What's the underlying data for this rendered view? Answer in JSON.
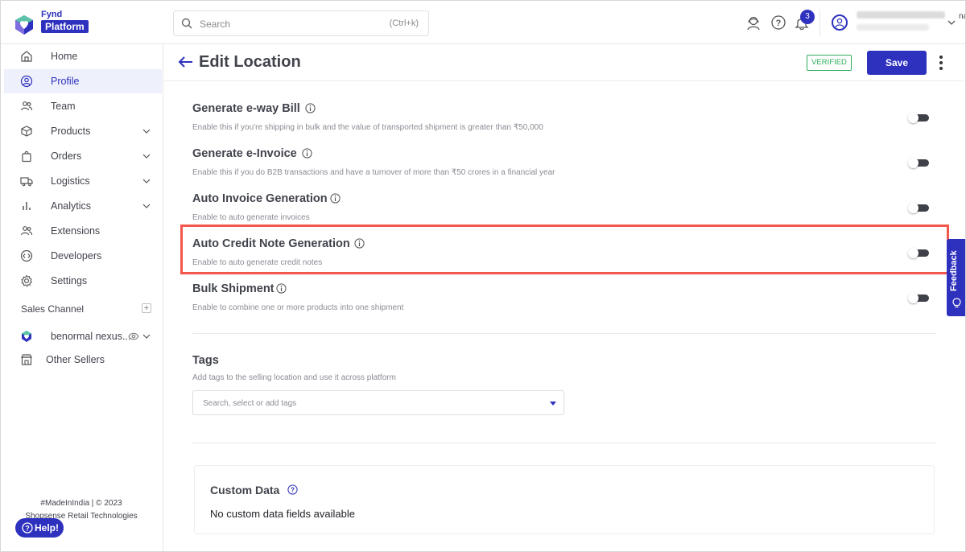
{
  "brand": {
    "line1": "Fynd",
    "line2": "Platform"
  },
  "search": {
    "placeholder": "Search",
    "shortcut": "(Ctrl+k)"
  },
  "header": {
    "notification_count": "3",
    "overflow_text": "na"
  },
  "sidebar": {
    "items": [
      {
        "label": "Home",
        "icon": "home-icon"
      },
      {
        "label": "Profile",
        "icon": "profile-icon",
        "active": true
      },
      {
        "label": "Team",
        "icon": "team-icon"
      },
      {
        "label": "Products",
        "icon": "box-icon",
        "expandable": true
      },
      {
        "label": "Orders",
        "icon": "shopping-bag-icon",
        "expandable": true
      },
      {
        "label": "Logistics",
        "icon": "truck-icon",
        "expandable": true
      },
      {
        "label": "Analytics",
        "icon": "bar-chart-icon",
        "expandable": true
      },
      {
        "label": "Extensions",
        "icon": "extensions-icon"
      },
      {
        "label": "Developers",
        "icon": "code-icon"
      },
      {
        "label": "Settings",
        "icon": "gear-icon"
      }
    ],
    "sales_channel_label": "Sales Channel",
    "channel_name": "benormal nexus...",
    "other_sellers_label": "Other Sellers",
    "footer_made": "#MadeInIndia | © 2023",
    "footer_company": "Shopsense Retail Technologies",
    "help_label": "Help!"
  },
  "page": {
    "title": "Edit Location",
    "status_badge": "VERIFIED",
    "save_label": "Save"
  },
  "settings": [
    {
      "title": "Generate e-way Bill",
      "desc": "Enable this if you're shipping in bulk and the value of transported shipment is greater than ₹50,000",
      "enabled": false
    },
    {
      "title": "Generate e-Invoice",
      "desc": "Enable this if you do B2B transactions and have a turnover of more than ₹50 crores in a financial year",
      "enabled": false
    },
    {
      "title": "Auto Invoice Generation",
      "desc": "Enable to auto generate invoices",
      "enabled": false
    },
    {
      "title": "Auto Credit Note Generation",
      "desc": "Enable to auto generate credit notes",
      "enabled": false,
      "highlighted": true
    },
    {
      "title": "Bulk Shipment",
      "desc": "Enable to combine one or more products into one shipment",
      "enabled": false
    }
  ],
  "tags": {
    "title": "Tags",
    "desc": "Add tags to the selling location and use it across platform",
    "placeholder": "Search, select or add tags"
  },
  "custom_data": {
    "title": "Custom Data",
    "empty_text": "No custom data fields available"
  },
  "feedback_label": "Feedback",
  "colors": {
    "accent": "#2e31be",
    "verified": "#2eae5b",
    "highlight": "#f2574c"
  }
}
